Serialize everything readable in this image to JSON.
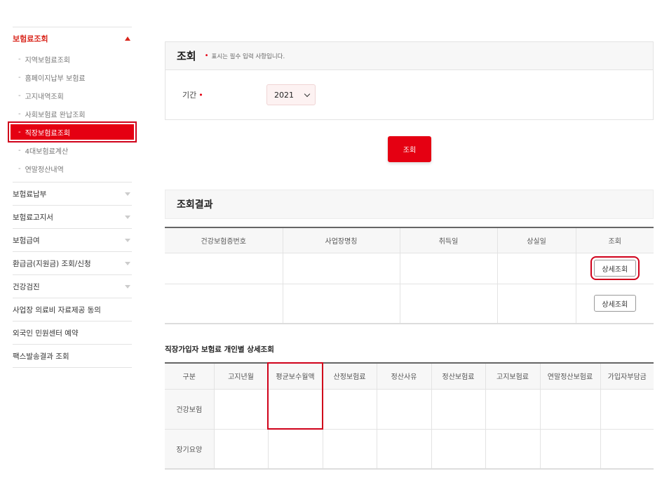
{
  "sidebar": {
    "top": {
      "label": "보험료조회"
    },
    "sub_items": [
      {
        "label": "지역보험료조회"
      },
      {
        "label": "홈페이지납부 보험료"
      },
      {
        "label": "고지내역조회"
      },
      {
        "label": "사회보험료 완납조회"
      },
      {
        "label": "직장보험료조회"
      },
      {
        "label": "4대보험료계산"
      },
      {
        "label": "연말정산내역"
      }
    ],
    "main_items": [
      {
        "label": "보험료납부"
      },
      {
        "label": "보험료고지서"
      },
      {
        "label": "보험급여"
      },
      {
        "label": "환급금(지원금) 조회/신청"
      },
      {
        "label": "건강검진"
      },
      {
        "label": "사업장 의료비 자료제공 동의"
      },
      {
        "label": "외국인 민원센터 예약"
      },
      {
        "label": "팩스발송결과 조회"
      }
    ]
  },
  "query": {
    "title": "조회",
    "note": "표시는 필수 입력 사항입니다.",
    "period_label": "기간",
    "year": "2021",
    "button": "조회"
  },
  "results": {
    "title": "조회결과",
    "columns": [
      "건강보험증번호",
      "사업장명칭",
      "취득일",
      "상실일",
      "조회"
    ],
    "detail_button": "상세조회"
  },
  "detail": {
    "title": "직장가입자 보험료 개인별 상세조회",
    "columns": [
      "구분",
      "고지년월",
      "평균보수월액",
      "산정보험료",
      "정산사유",
      "정산보험료",
      "고지보험료",
      "연말정산보험료",
      "가입자부담금"
    ],
    "rows": [
      {
        "label": "건강보험"
      },
      {
        "label": "장기요양"
      }
    ]
  },
  "colors": {
    "accent": "#e50012",
    "highlight": "#d0021b"
  }
}
